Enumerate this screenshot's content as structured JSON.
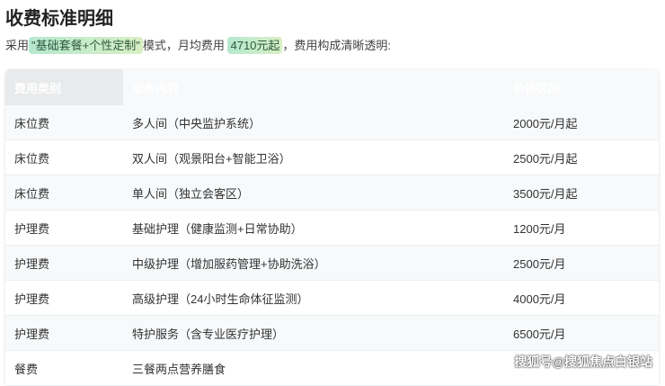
{
  "title": "收费标准明细",
  "intro": {
    "prefix": "采用",
    "highlight1": "\"基础套餐+个性定制\"",
    "middle": "模式，月均费用",
    "highlight2": "4710元起",
    "suffix": "，费用构成清晰透明:"
  },
  "table": {
    "headers": [
      "费用类别",
      "服务内容",
      "价格区间"
    ],
    "rows": [
      [
        "床位费",
        "多人间（中央监护系统）",
        "2000元/月起"
      ],
      [
        "床位费",
        "双人间（观景阳台+智能卫浴）",
        "2500元/月起"
      ],
      [
        "床位费",
        "单人间（独立会客区）",
        "3500元/月起"
      ],
      [
        "护理费",
        "基础护理（健康监测+日常协助）",
        "1200元/月"
      ],
      [
        "护理费",
        "中级护理（增加服药管理+协助洗浴）",
        "2500元/月"
      ],
      [
        "护理费",
        "高级护理（24小时生命体征监测）",
        "4000元/月"
      ],
      [
        "护理费",
        "特护服务（含专业医疗护理）",
        "6500元/月"
      ],
      [
        "餐费",
        "三餐两点营养膳食",
        ""
      ]
    ]
  },
  "watermark": "搜狐号@搜狐焦点白银站"
}
